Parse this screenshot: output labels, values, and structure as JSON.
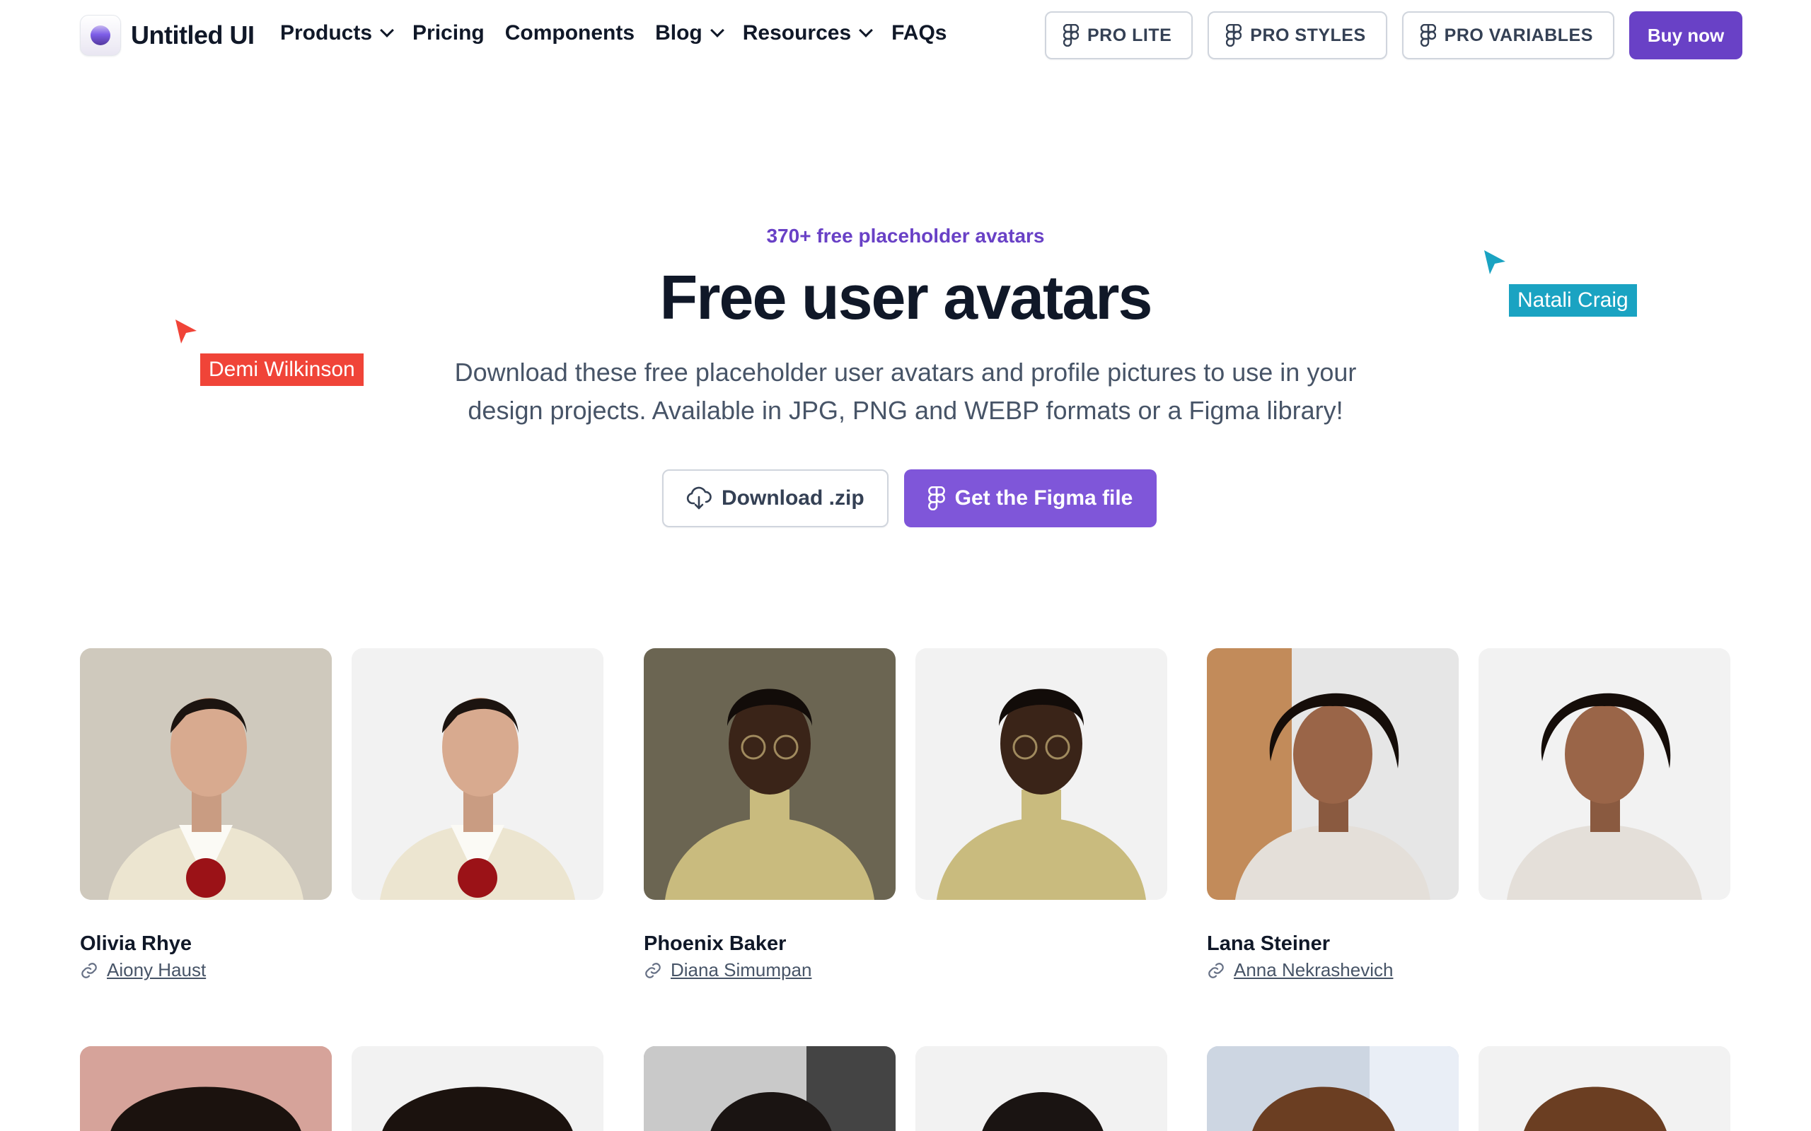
{
  "brand": {
    "name": "Untitled UI"
  },
  "nav": {
    "items": [
      {
        "label": "Products",
        "has_dropdown": true
      },
      {
        "label": "Pricing",
        "has_dropdown": false
      },
      {
        "label": "Components",
        "has_dropdown": false
      },
      {
        "label": "Blog",
        "has_dropdown": true
      },
      {
        "label": "Resources",
        "has_dropdown": true
      },
      {
        "label": "FAQs",
        "has_dropdown": false
      }
    ],
    "pro_buttons": [
      "PRO LITE",
      "PRO STYLES",
      "PRO VARIABLES"
    ],
    "buy_label": "Buy now"
  },
  "hero": {
    "eyebrow": "370+ free placeholder avatars",
    "title": "Free user avatars",
    "subtitle_line1": "Download these free placeholder user avatars and profile pictures to use in your",
    "subtitle_line2": "design projects. Available in JPG, PNG and WEBP formats or a Figma library!",
    "download_label": "Download .zip",
    "figma_label": "Get the Figma file"
  },
  "cursors": [
    {
      "label": "Demi Wilkinson",
      "color": "#f04438"
    },
    {
      "label": "Natali Craig",
      "color": "#1aa3c2"
    }
  ],
  "avatars": [
    {
      "name": "Olivia Rhye",
      "credit": "Aiony Haust"
    },
    {
      "name": "Phoenix Baker",
      "credit": "Diana Simumpan"
    },
    {
      "name": "Lana Steiner",
      "credit": "Anna Nekrashevich"
    }
  ],
  "colors": {
    "brand_purple": "#6941c6",
    "button_purple": "#7f56d9",
    "text_primary": "#101828",
    "text_secondary": "#475467"
  }
}
